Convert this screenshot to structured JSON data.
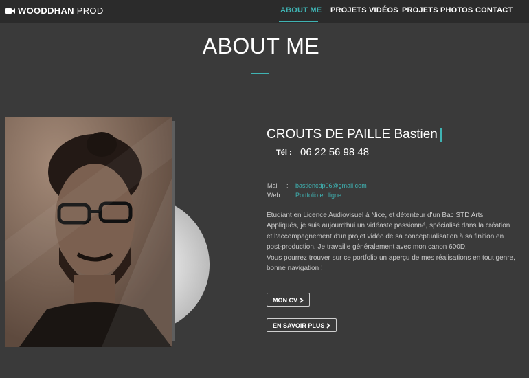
{
  "brand": {
    "name_bold": "WOODDHAN",
    "name_light": "PROD"
  },
  "nav": {
    "items": [
      {
        "label": "ABOUT ME",
        "active": true
      },
      {
        "label": "PROJETS VIDÉOS",
        "active": false
      },
      {
        "label": "PROJETS PHOTOS",
        "active": false
      },
      {
        "label": "CONTACT",
        "active": false
      }
    ]
  },
  "page": {
    "title": "ABOUT ME"
  },
  "profile": {
    "name": "CROUTS DE PAILLE Bastien",
    "tel_label": "Tél :",
    "tel_value": "06 22 56 98 48",
    "mail_label": "Mail",
    "mail_value": "bastiencdp06@gmail.com",
    "web_label": "Web",
    "web_value": "Portfolio en ligne",
    "separator": ":"
  },
  "bio": {
    "paragraph1": "Etudiant en Licence Audiovisuel à Nice, et détenteur d'un Bac STD Arts Appliqués, je suis aujourd'hui un vidéaste passionné, spécialisé dans la création et l'accompagnement d'un projet vidéo de sa conceptualisation à sa finition en post-production. Je travaille généralement avec mon canon 600D.",
    "paragraph2": "Vous pourrez trouver sur ce portfolio un aperçu de mes réalisations en tout genre, bonne navigation !"
  },
  "buttons": {
    "cv_label": "MON CV",
    "more_label": "EN SAVOIR PLUS"
  },
  "icons": {
    "brand_icon": "video-camera-icon",
    "button_icon": "chevron-right-icon"
  },
  "colors": {
    "accent": "#3fb3b3",
    "background": "#3a3a3a",
    "navbar": "#2b2b2b"
  }
}
